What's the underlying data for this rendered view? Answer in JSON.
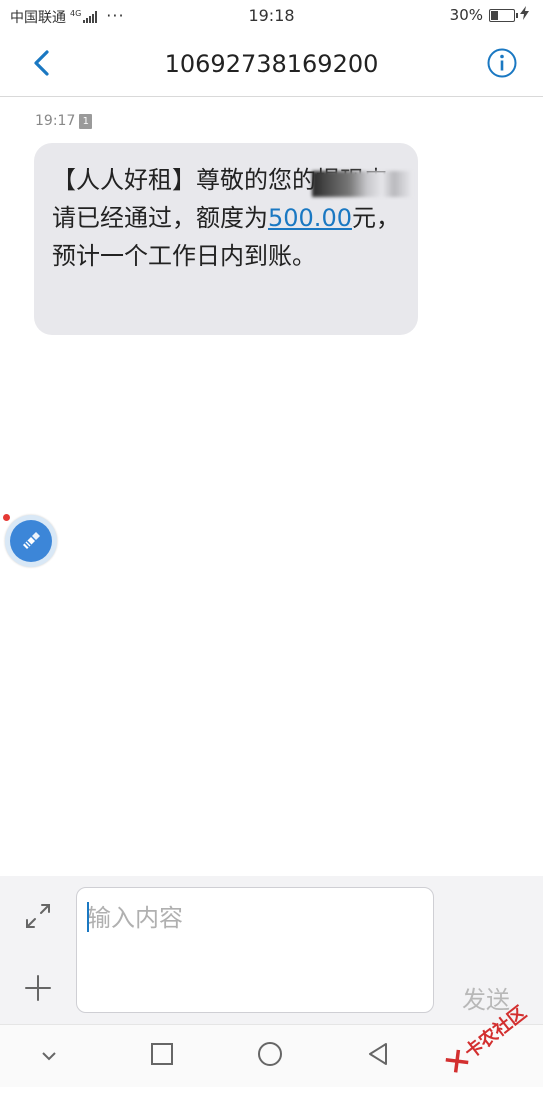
{
  "status_bar": {
    "carrier": "中国联通",
    "network": "4G",
    "more": "···",
    "time": "19:18",
    "battery": "30%",
    "battery_level": 0.3,
    "charging_icon": "bolt-icon"
  },
  "header": {
    "title": "10692738169200",
    "back_icon": "chevron-left-icon",
    "info_icon": "info-icon"
  },
  "message": {
    "time": "19:17",
    "sim": "1",
    "text_before": "【人人好租】尊敬的",
    "text_middle": "您的提现申请已经通过，额度为",
    "amount": "500.00",
    "text_after": "元，预计一个工作日内到账。"
  },
  "composer": {
    "placeholder": "输入内容",
    "send_label": "发送"
  },
  "watermark": {
    "text": "卡农社区"
  },
  "colors": {
    "accent": "#1a78c2",
    "bubble": "#e8e8ec",
    "composer_bg": "#f3f3f5",
    "watermark": "#d32f2f"
  }
}
